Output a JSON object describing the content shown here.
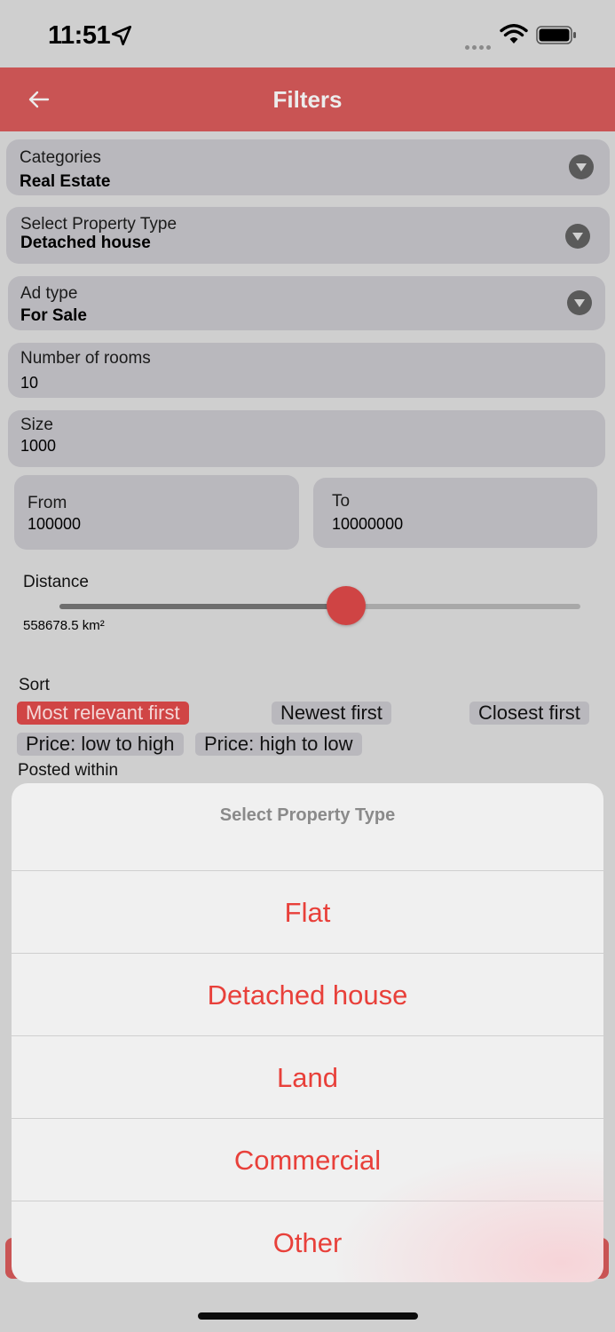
{
  "status_bar": {
    "time": "11:51"
  },
  "app_bar": {
    "title": "Filters"
  },
  "filters": {
    "category": {
      "label": "Categories",
      "value": "Real Estate"
    },
    "property_type": {
      "label": "Select Property Type",
      "value": "Detached house"
    },
    "ad_type": {
      "label": "Ad type",
      "value": "For Sale"
    },
    "rooms": {
      "label": "Number of rooms",
      "value": "10"
    },
    "size": {
      "label": "Size",
      "value": "1000"
    },
    "price_from": {
      "label": "From",
      "value": "100000"
    },
    "price_to": {
      "label": "To",
      "value": "10000000"
    },
    "distance": {
      "label": "Distance",
      "value_text": "558678.5 km²",
      "slider_fraction": 0.55
    }
  },
  "sort": {
    "label": "Sort",
    "options": [
      "Most relevant first",
      "Newest first",
      "Closest first",
      "Price: low to high",
      "Price: high to low"
    ],
    "selected_index": 0
  },
  "posted_within": {
    "label": "Posted within"
  },
  "action_sheet": {
    "title": "Select Property Type",
    "options": [
      "Flat",
      "Detached house",
      "Land",
      "Commercial",
      "Other"
    ]
  },
  "colors": {
    "accent": "#c95454",
    "chip_selected": "#d04545",
    "sheet_option_text": "#e8403a",
    "field_background": "#b9b8bd"
  },
  "icons": {
    "back": "arrow-left-icon",
    "dropdown": "dropdown-triangle-icon",
    "location": "location-arrow-icon",
    "wifi": "wifi-icon",
    "battery": "battery-icon"
  }
}
